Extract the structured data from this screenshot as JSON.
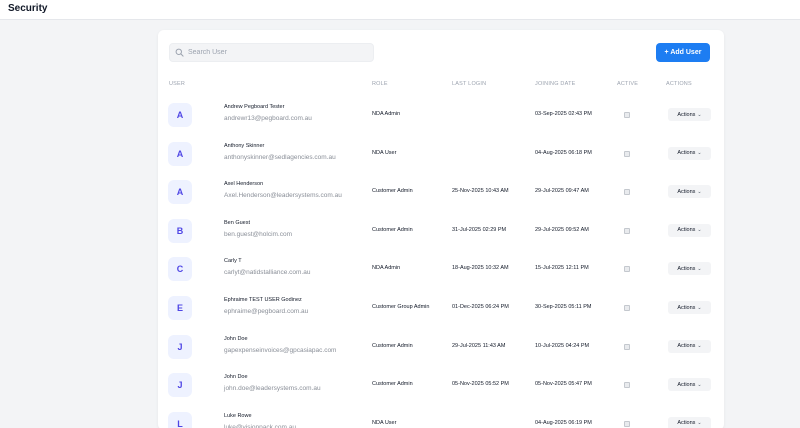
{
  "page": {
    "title": "Security"
  },
  "toolbar": {
    "search_placeholder": "Search User",
    "search_value": "",
    "add_user_label": "+ Add User"
  },
  "colors": {
    "accent": "#1d7df2",
    "avatar_text": "#4f46e5",
    "avatar_bg": "#eef2ff"
  },
  "table": {
    "columns": {
      "user": "USER",
      "role": "ROLE",
      "last_login": "LAST LOGIN",
      "joining_date": "JOINING DATE",
      "active": "ACTIVE",
      "actions": "ACTIONS"
    },
    "rows": [
      {
        "initial": "A",
        "name": "Andrew Pegboard Tester",
        "email": "andrewr13@pegboard.com.au",
        "role": "NDA Admin",
        "last_login": "",
        "joining_date": "03-Sep-2025 02:43 PM",
        "active": false,
        "actions_label": "Actions"
      },
      {
        "initial": "A",
        "name": "Anthony Skinner",
        "email": "anthonyskinner@sedlagencies.com.au",
        "role": "NDA User",
        "last_login": "",
        "joining_date": "04-Aug-2025 06:18 PM",
        "active": false,
        "actions_label": "Actions"
      },
      {
        "initial": "A",
        "name": "Axel Henderson",
        "email": "Axel.Henderson@leadersystems.com.au",
        "role": "Customer Admin",
        "last_login": "25-Nov-2025 10:43 AM",
        "joining_date": "29-Jul-2025 09:47 AM",
        "active": false,
        "actions_label": "Actions"
      },
      {
        "initial": "B",
        "name": "Ben Guest",
        "email": "ben.guest@holcim.com",
        "role": "Customer Admin",
        "last_login": "31-Jul-2025 02:29 PM",
        "joining_date": "29-Jul-2025 09:52 AM",
        "active": false,
        "actions_label": "Actions"
      },
      {
        "initial": "C",
        "name": "Carly T",
        "email": "carlyt@natidstalliance.com.au",
        "role": "NDA Admin",
        "last_login": "18-Aug-2025 10:32 AM",
        "joining_date": "15-Jul-2025 12:11 PM",
        "active": false,
        "actions_label": "Actions"
      },
      {
        "initial": "E",
        "name": "Ephraime TEST USER Godinez",
        "email": "ephraime@pegboard.com.au",
        "role": "Customer Group Admin",
        "last_login": "01-Dec-2025 06:24 PM",
        "joining_date": "30-Sep-2025 05:11 PM",
        "active": false,
        "actions_label": "Actions"
      },
      {
        "initial": "J",
        "name": "John Doe",
        "email": "gapexpenseinvoices@gpcasiapac.com",
        "role": "Customer Admin",
        "last_login": "29-Jul-2025 11:43 AM",
        "joining_date": "10-Jul-2025 04:24 PM",
        "active": false,
        "actions_label": "Actions"
      },
      {
        "initial": "J",
        "name": "John Doe",
        "email": "john.doe@leadersystems.com.au",
        "role": "Customer Admin",
        "last_login": "05-Nov-2025 05:52 PM",
        "joining_date": "05-Nov-2025 05:47 PM",
        "active": false,
        "actions_label": "Actions"
      },
      {
        "initial": "L",
        "name": "Luke Rowe",
        "email": "luke@visionpack.com.au",
        "role": "NDA User",
        "last_login": "",
        "joining_date": "04-Aug-2025 06:19 PM",
        "active": false,
        "actions_label": "Actions"
      }
    ]
  }
}
